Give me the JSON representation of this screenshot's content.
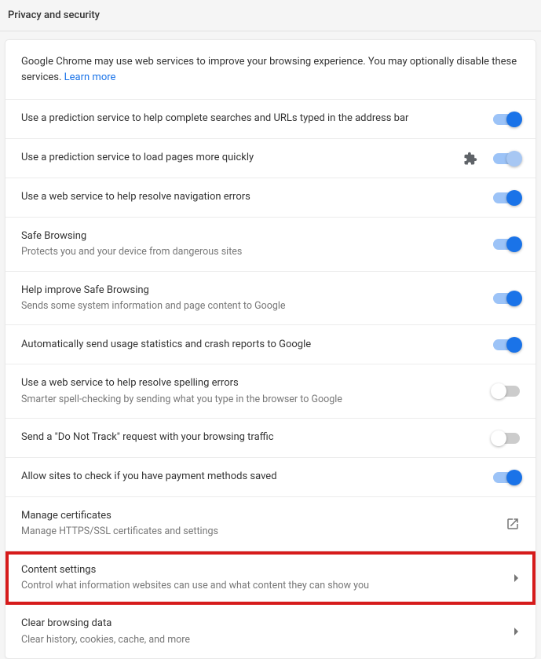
{
  "header": {
    "title": "Privacy and security"
  },
  "intro": {
    "text": "Google Chrome may use web services to improve your browsing experience. You may optionally disable these services. ",
    "link": "Learn more"
  },
  "rows": [
    {
      "title": "Use a prediction service to help complete searches and URLs typed in the address bar",
      "sub": "",
      "control": "toggle",
      "state": "on"
    },
    {
      "title": "Use a prediction service to load pages more quickly",
      "sub": "",
      "control": "toggle-ext",
      "state": "on-dim"
    },
    {
      "title": "Use a web service to help resolve navigation errors",
      "sub": "",
      "control": "toggle",
      "state": "on"
    },
    {
      "title": "Safe Browsing",
      "sub": "Protects you and your device from dangerous sites",
      "control": "toggle",
      "state": "on"
    },
    {
      "title": "Help improve Safe Browsing",
      "sub": "Sends some system information and page content to Google",
      "control": "toggle",
      "state": "on"
    },
    {
      "title": "Automatically send usage statistics and crash reports to Google",
      "sub": "",
      "control": "toggle",
      "state": "on"
    },
    {
      "title": "Use a web service to help resolve spelling errors",
      "sub": "Smarter spell-checking by sending what you type in the browser to Google",
      "control": "toggle",
      "state": "off"
    },
    {
      "title": "Send a \"Do Not Track\" request with your browsing traffic",
      "sub": "",
      "control": "toggle",
      "state": "off"
    },
    {
      "title": "Allow sites to check if you have payment methods saved",
      "sub": "",
      "control": "toggle",
      "state": "on"
    },
    {
      "title": "Manage certificates",
      "sub": "Manage HTTPS/SSL certificates and settings",
      "control": "external",
      "state": ""
    },
    {
      "title": "Content settings",
      "sub": "Control what information websites can use and what content they can show you",
      "control": "arrow",
      "state": "",
      "highlight": true
    },
    {
      "title": "Clear browsing data",
      "sub": "Clear history, cookies, cache, and more",
      "control": "arrow",
      "state": ""
    }
  ]
}
